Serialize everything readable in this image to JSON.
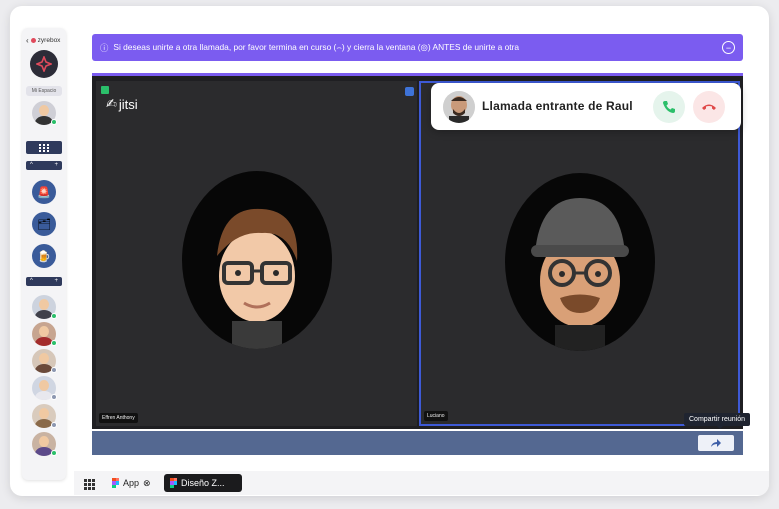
{
  "sidebar": {
    "brand": "zyrebox",
    "workspace_label": "Mi Espacio",
    "toggle_up": "^",
    "toggle_add": "+"
  },
  "banner": {
    "icon": "info-icon",
    "text": "Si deseas unirte a otra llamada, por favor termina en curso (⌢) y cierra la ventana (◎) ANTES de unirte a otra",
    "close": "−"
  },
  "call": {
    "logo": "jitsi",
    "participants": [
      {
        "name": "Effren Anthony"
      },
      {
        "name": "Luciano"
      }
    ]
  },
  "incoming_call": {
    "title": "Llamada entrante de Raul"
  },
  "bottom_bar": {
    "tooltip": "Compartir reunión"
  },
  "taskbar": {
    "tabs": [
      {
        "label": "App"
      },
      {
        "label": "Diseño Z..."
      }
    ]
  },
  "colors": {
    "accent": "#7b5cf0",
    "bottom_bar": "#546891",
    "accept": "#2bbf6a",
    "reject": "#e04848"
  }
}
